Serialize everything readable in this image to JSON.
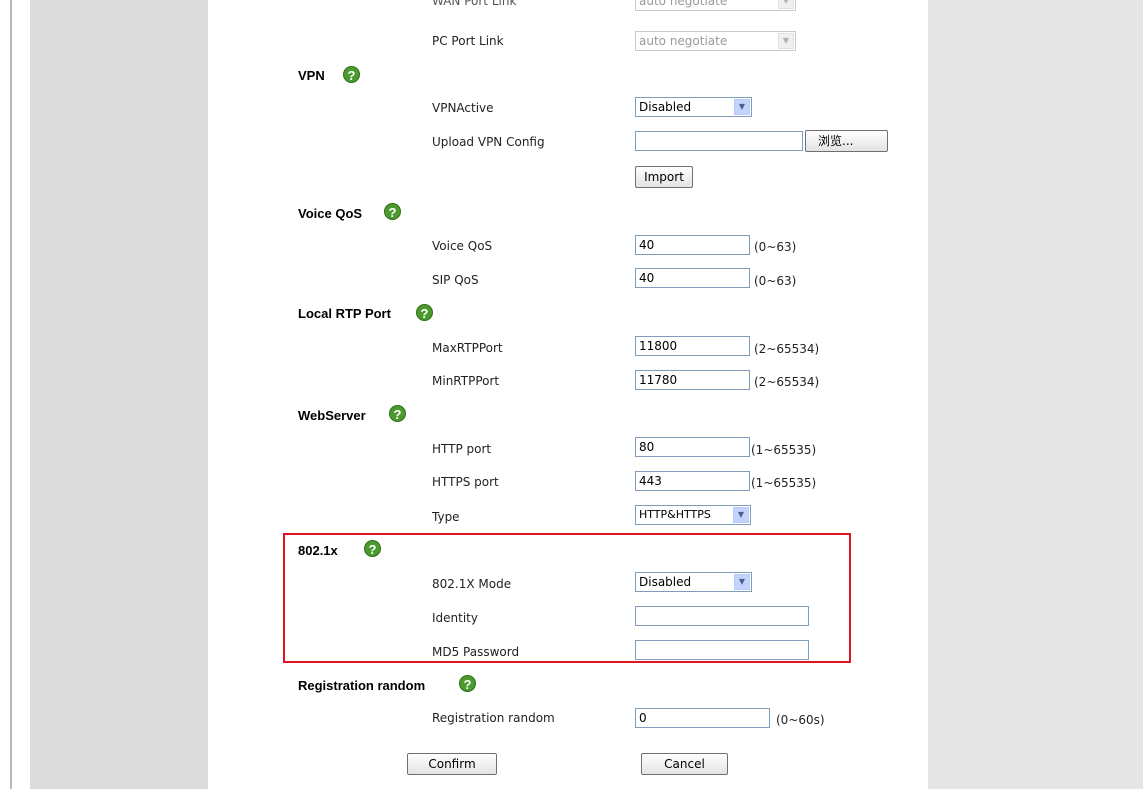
{
  "top_partial": {
    "label": "WAN Port Link",
    "value": "auto negotiate"
  },
  "pc_port": {
    "label": "PC Port Link",
    "value": "auto negotiate"
  },
  "vpn": {
    "title": "VPN",
    "active_label": "VPNActive",
    "active_value": "Disabled",
    "upload_label": "Upload VPN Config",
    "browse_label": "浏览...",
    "import_label": "Import"
  },
  "voice_qos": {
    "title": "Voice QoS",
    "voice_label": "Voice QoS",
    "voice_value": "40",
    "voice_range": "(0~63)",
    "sip_label": "SIP QoS",
    "sip_value": "40",
    "sip_range": "(0~63)"
  },
  "rtp": {
    "title": "Local RTP Port",
    "max_label": "MaxRTPPort",
    "max_value": "11800",
    "max_range": "(2~65534)",
    "min_label": "MinRTPPort",
    "min_value": "11780",
    "min_range": "(2~65534)"
  },
  "webserver": {
    "title": "WebServer",
    "http_label": "HTTP port",
    "http_value": "80",
    "http_range": "(1~65535)",
    "https_label": "HTTPS port",
    "https_value": "443",
    "https_range": "(1~65535)",
    "type_label": "Type",
    "type_value": "HTTP&HTTPS"
  },
  "dot1x": {
    "title": "802.1x",
    "mode_label": "802.1X Mode",
    "mode_value": "Disabled",
    "identity_label": "Identity",
    "identity_value": "",
    "password_label": "MD5 Password",
    "password_value": ""
  },
  "registration": {
    "title": "Registration random",
    "label": "Registration random",
    "value": "0",
    "range": "(0~60s)"
  },
  "actions": {
    "confirm": "Confirm",
    "cancel": "Cancel"
  },
  "help_glyph": "?",
  "icons": {
    "help": "help-icon",
    "dropdown": "chevron-down-icon"
  },
  "colors": {
    "highlight_border": "#e0141e",
    "help_icon": "#4a9a2e"
  }
}
